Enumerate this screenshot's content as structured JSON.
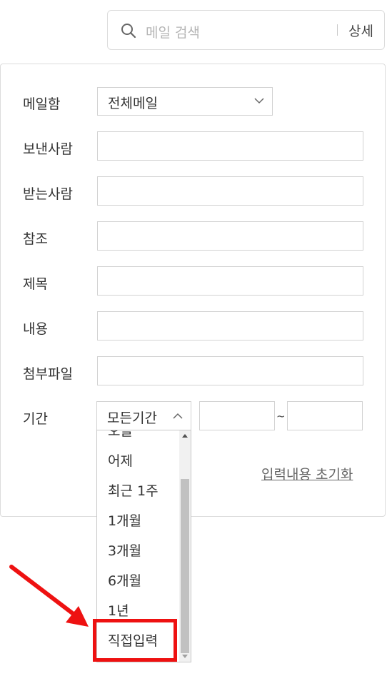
{
  "search": {
    "placeholder": "메일 검색",
    "detail_label": "상세"
  },
  "form": {
    "mailbox": {
      "label": "메일함",
      "value": "전체메일"
    },
    "from": {
      "label": "보낸사람",
      "value": ""
    },
    "to": {
      "label": "받는사람",
      "value": ""
    },
    "cc": {
      "label": "참조",
      "value": ""
    },
    "subject": {
      "label": "제목",
      "value": ""
    },
    "content": {
      "label": "내용",
      "value": ""
    },
    "attachment": {
      "label": "첨부파일",
      "value": ""
    },
    "period": {
      "label": "기간",
      "value": "모든기간",
      "start_date": "",
      "separator": "~",
      "end_date": ""
    },
    "reset_label": "입력내용 초기화"
  },
  "period_dropdown": {
    "options": [
      "오늘",
      "어제",
      "최근 1주",
      "1개월",
      "3개월",
      "6개월",
      "1년",
      "직접입력"
    ],
    "highlighted": "직접입력"
  },
  "colors": {
    "annotation": "#ee1111",
    "border": "#d2d2d2",
    "text": "#333333",
    "link": "#666666"
  }
}
